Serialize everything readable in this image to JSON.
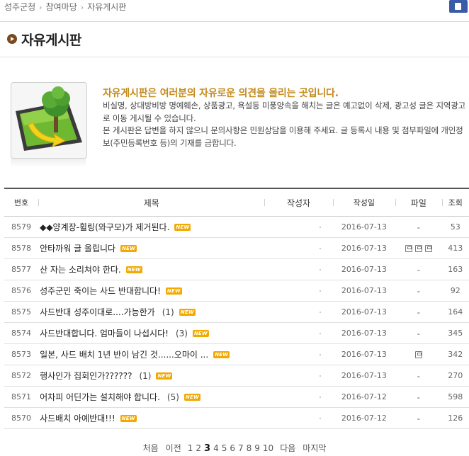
{
  "breadcrumb": [
    "성주군청",
    "참여마당",
    "자유게시판"
  ],
  "page_title": "자유게시판",
  "intro": {
    "heading": "자유게시판은 여러분의 자유로운 의견을 올리는 곳입니다.",
    "lines": [
      "비실명, 상대방비방 명예훼손, 상품광고, 욕설등 미풍양속을 해치는 글은 예고없이 삭제, 광고성 글은 지역광고로 이동 게시될 수 있습니다.",
      "본 게시판은 답변을 하지 않으니 문의사항은 민원상담을 이용해 주세요. 글 등록시 내용 및 첨부파일에 개인정보(주민등록번호 등)의 기재를 금합니다."
    ]
  },
  "table": {
    "headers": [
      "번호",
      "제목",
      "작성자",
      "작성일",
      "파일",
      "조회"
    ],
    "new_label": "NEW",
    "rows": [
      {
        "no": "8579",
        "title": "◆◆양계장-휠링(와구모)가 제거된다.",
        "comments": "",
        "date": "2016-07-13",
        "file": "-",
        "file_icons": 0,
        "views": "53"
      },
      {
        "no": "8578",
        "title": "안타까워 글 올립니다",
        "comments": "",
        "date": "2016-07-13",
        "file": "",
        "file_icons": 3,
        "views": "413"
      },
      {
        "no": "8577",
        "title": "산 자는 소리쳐야 한다.",
        "comments": "",
        "date": "2016-07-13",
        "file": "-",
        "file_icons": 0,
        "views": "163"
      },
      {
        "no": "8576",
        "title": "성주군민 죽이는 사드 반대합니다!",
        "comments": "",
        "date": "2016-07-13",
        "file": "-",
        "file_icons": 0,
        "views": "92"
      },
      {
        "no": "8575",
        "title": "사드반대 성주이대로....가능한가",
        "comments": "(1)",
        "date": "2016-07-13",
        "file": "-",
        "file_icons": 0,
        "views": "164"
      },
      {
        "no": "8574",
        "title": "사드반대합니다. 엄마들이 나섭시다!",
        "comments": "(3)",
        "date": "2016-07-13",
        "file": "-",
        "file_icons": 0,
        "views": "345"
      },
      {
        "no": "8573",
        "title": "일본, 사드 배치 1년 반이 남긴 것......오마이 ...",
        "comments": "",
        "date": "2016-07-13",
        "file": "",
        "file_icons": 1,
        "views": "342"
      },
      {
        "no": "8572",
        "title": "행사인가 집회인가??????",
        "comments": "(1)",
        "date": "2016-07-13",
        "file": "-",
        "file_icons": 0,
        "views": "270"
      },
      {
        "no": "8571",
        "title": "어차피 어딘가는 설치해야 합니다.",
        "comments": "(5)",
        "date": "2016-07-12",
        "file": "-",
        "file_icons": 0,
        "views": "598"
      },
      {
        "no": "8570",
        "title": "사드배치 아예반대!!!",
        "comments": "",
        "date": "2016-07-12",
        "file": "-",
        "file_icons": 0,
        "views": "126"
      }
    ]
  },
  "pagination": {
    "first": "처음",
    "prev": "이전",
    "pages": [
      "1",
      "2",
      "3",
      "4",
      "5",
      "6",
      "7",
      "8",
      "9",
      "10"
    ],
    "current": "3",
    "next": "다음",
    "last": "마지막"
  },
  "colors": {
    "accent_heading": "#c48a1c",
    "title_bullet": "#7a4a1e",
    "top_button": "#3a5ba8",
    "new_badge": "#f2a900"
  }
}
